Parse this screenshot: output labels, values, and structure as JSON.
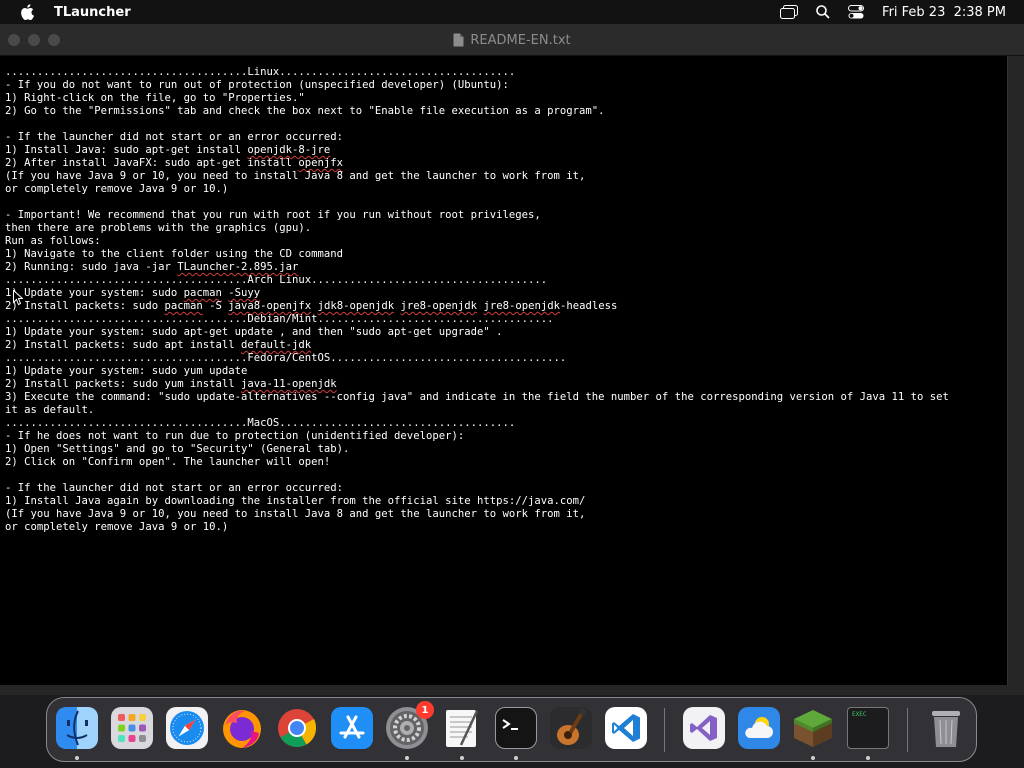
{
  "menubar": {
    "app_name": "TLauncher",
    "date": "Fri Feb 23",
    "time": "2:38 PM",
    "icons": [
      "apple-icon",
      "window-icon",
      "search-icon",
      "control-center-icon"
    ]
  },
  "window": {
    "title": "README-EN.txt",
    "doc_icon": "document-icon"
  },
  "text_lines": [
    "......................................Linux.....................................",
    "- If you do not want to run out of protection (unspecified developer) (Ubuntu):",
    "1) Right-click on the file, go to \"Properties.\"",
    "2) Go to the \"Permissions\" tab and check the box next to \"Enable file execution as a program\".",
    "",
    "- If the launcher did not start or an error occurred:",
    "1) Install Java: sudo apt-get install openjdk-8-jre",
    "2) After install JavaFX: sudo apt-get install openjfx",
    "(If you have Java 9 or 10, you need to install Java 8 and get the launcher to work from it,",
    "or completely remove Java 9 or 10.)",
    "",
    "- Important! We recommend that you run with root if you run without root privileges,",
    "then there are problems with the graphics (gpu).",
    "Run as follows:",
    "1) Navigate to the client folder using the CD command",
    "2) Running: sudo java -jar TLauncher-2.895.jar",
    "......................................Arch Linux.....................................",
    "1) Update your system: sudo pacman -Suyy",
    "2) Install packets: sudo pacman -S java8-openjfx jdk8-openjdk jre8-openjdk jre8-openjdk-headless",
    "......................................Debian/Mint.....................................",
    "1) Update your system: sudo apt-get update , and then \"sudo apt-get upgrade\" .",
    "2) Install packets: sudo apt install default-jdk",
    "......................................Fedora/CentOS.....................................",
    "1) Update your system: sudo yum update",
    "2) Install packets: sudo yum install java-11-openjdk",
    "3) Execute the command: \"sudo update-alternatives --config java\" and indicate in the field the number of the corresponding version of Java 11 to set",
    "it as default.",
    "......................................MacOS.....................................",
    "- If he does not want to run due to protection (unidentified developer):",
    "1) Open \"Settings\" and go to \"Security\" (General tab).",
    "2) Click on \"Confirm open\". The launcher will open!",
    "",
    "- If the launcher did not start or an error occurred:",
    "1) Install Java again by downloading the installer from the official site https://java.com/",
    "(If you have Java 9 or 10, you need to install Java 8 and get the launcher to work from it,",
    "or completely remove Java 9 or 10.)"
  ],
  "spellcheck_words": [
    "openjdk-8-jre",
    "openjfx",
    "TLauncher-2.895.jar",
    "pacman",
    "-Suyy",
    "java8-openjfx",
    "jdk8-openjdk",
    "jre8-openjdk",
    "jre8-openjdk-headless",
    "default-jdk",
    "java-11-openjdk"
  ],
  "dock": {
    "items": [
      {
        "name": "finder-icon",
        "running": true
      },
      {
        "name": "launchpad-icon",
        "running": false
      },
      {
        "name": "safari-icon",
        "running": false
      },
      {
        "name": "firefox-icon",
        "running": false
      },
      {
        "name": "chrome-icon",
        "running": false
      },
      {
        "name": "app-store-icon",
        "running": false
      },
      {
        "name": "system-settings-icon",
        "running": true,
        "badge": "1"
      },
      {
        "name": "textedit-icon",
        "running": true
      },
      {
        "name": "terminal-icon",
        "running": true
      },
      {
        "name": "garageband-icon",
        "running": false
      },
      {
        "name": "vscode-icon",
        "running": false
      },
      {
        "name": "visual-studio-icon",
        "running": false
      },
      {
        "name": "weather-icon",
        "running": false
      },
      {
        "name": "minecraft-icon",
        "running": true
      },
      {
        "name": "exec-icon",
        "running": true,
        "label": "exec"
      },
      {
        "name": "trash-icon",
        "running": false
      }
    ]
  }
}
